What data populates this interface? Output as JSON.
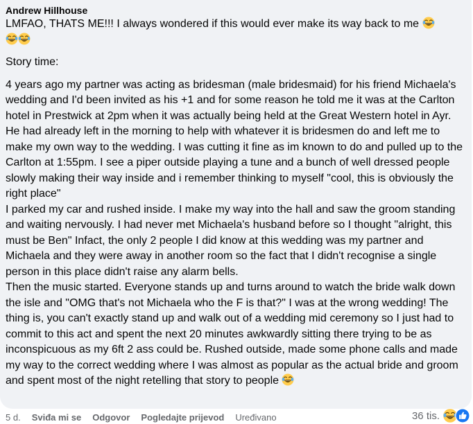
{
  "comment": {
    "author": "Andrew Hillhouse",
    "line1": "LMFAO, THATS ME!!! I always wondered if this would ever make its way back to me",
    "story_label": "Story time:",
    "paragraph1": "4 years ago my partner was acting as bridesman (male bridesmaid) for his friend Michaela's wedding and I'd been invited as his +1 and for some reason he told me it was at the Carlton hotel in Prestwick at 2pm when it was actually being held at the Great Western hotel in Ayr. He had already left in the morning to help with whatever it is bridesmen do and left me to make my own way to the wedding. I was cutting it fine as im known to do and pulled up to the Carlton at 1:55pm. I see a piper outside playing a tune and a bunch of well dressed people slowly making their way inside and i remember thinking to myself \"cool, this is obviously the right place\"",
    "paragraph2": "I parked my car and rushed inside. I make my way into the hall and saw the groom standing and waiting nervously. I had never met Michaela's husband before so I thought \"alright, this must be Ben\" Infact, the only 2 people I did know at this wedding was my partner and Michaela and they were away in another room so the fact that I didn't recognise a single person in this place didn't raise any alarm bells.",
    "paragraph3": "Then the music started. Everyone stands up and turns around to watch the bride walk down the isle and \"OMG that's not Michaela who the F is that?\" I was at the wrong wedding! The thing is, you can't exactly stand up and walk out of a wedding mid ceremony so I just had to commit to this act and spent the next 20 minutes awkwardly sitting there trying to be as inconspicuous as my 6ft 2 ass could be. Rushed outside, made some phone calls and made my way to the correct wedding where I was almost as popular as the actual bride and groom and spent most of the night retelling that story to people",
    "emoji_icon": "laughing-tears-emoji"
  },
  "footer": {
    "time": "5 d.",
    "like": "Sviđa mi se",
    "reply": "Odgovor",
    "translate": "Pogledajte prijevod",
    "edited": "Uređivano"
  },
  "reactions": {
    "count": "36 tis.",
    "icons": [
      "haha-reaction-icon",
      "like-reaction-icon"
    ],
    "colors": {
      "like": "#1877f2",
      "haha": "#f7b125"
    }
  }
}
